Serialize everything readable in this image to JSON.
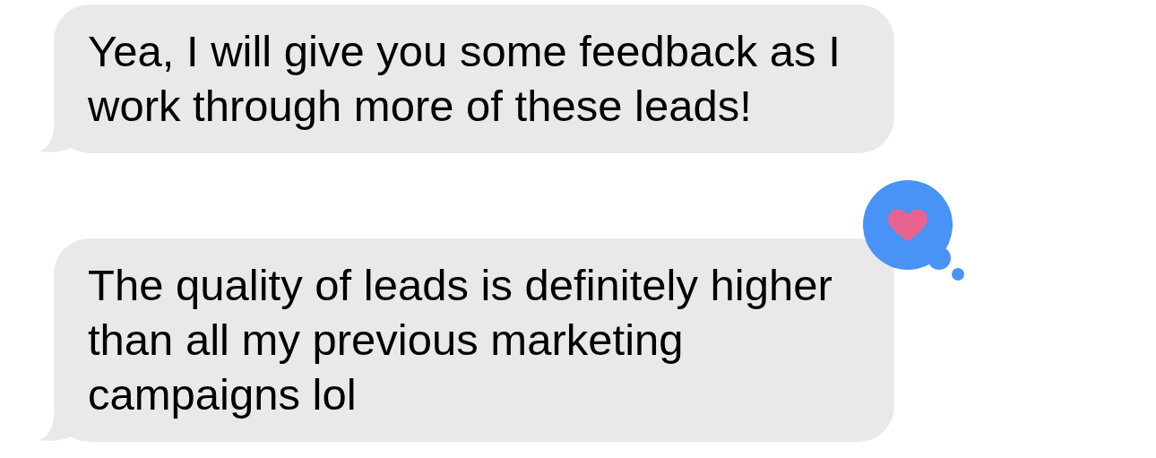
{
  "messages": [
    {
      "text": "Yea, I will give you some feedback as I work through more of these leads!",
      "heart_reaction": false
    },
    {
      "text": "The quality of leads is definitely higher than all my previous marketing campaigns lol",
      "heart_reaction": true
    }
  ]
}
